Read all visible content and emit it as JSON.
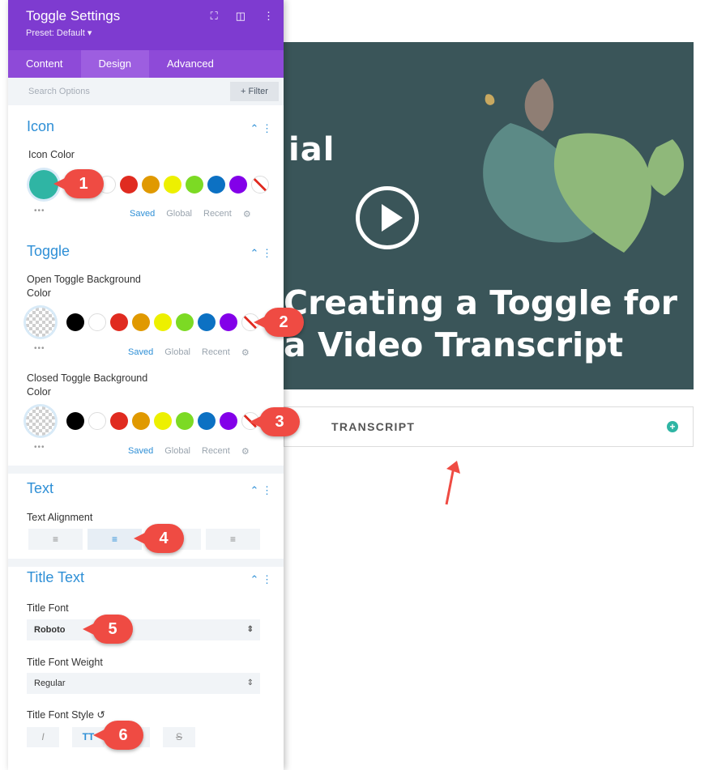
{
  "panel": {
    "title": "Toggle Settings",
    "preset": "Preset: Default ▾",
    "tabs": [
      "Content",
      "Design",
      "Advanced"
    ],
    "search_placeholder": "Search Options",
    "filter_label": "+ Filter",
    "sections": {
      "icon": {
        "title": "Icon",
        "color_label": "Icon Color"
      },
      "toggle": {
        "title": "Toggle",
        "open_label": "Open Toggle Background\nColor",
        "closed_label": "Closed Toggle Background\nColor"
      },
      "text": {
        "title": "Text",
        "align_label": "Text Alignment"
      },
      "title_text": {
        "title": "Title Text",
        "font_label": "Title Font",
        "font_value": "Roboto",
        "weight_label": "Title Font Weight",
        "weight_value": "Regular",
        "style_label": "Title Font Style"
      }
    },
    "palette_tabs": [
      "Saved",
      "Global",
      "Recent"
    ],
    "swatch_colors": [
      "#000000",
      "#ffffff",
      "#e02b20",
      "#e09900",
      "#edf000",
      "#7cda24",
      "#0c71c3",
      "#8300e9"
    ],
    "icon_color": "#2fb5a4",
    "accent": "#7e3bd0",
    "style_buttons": [
      "I",
      "TT",
      "U",
      "S"
    ]
  },
  "preview": {
    "title_fragment": "ial",
    "heading_line1": "Creating a Toggle for",
    "heading_line2": "a Video Transcript",
    "toggle_label": "TRANSCRIPT"
  },
  "markers": [
    "1",
    "2",
    "3",
    "4",
    "5",
    "6"
  ]
}
